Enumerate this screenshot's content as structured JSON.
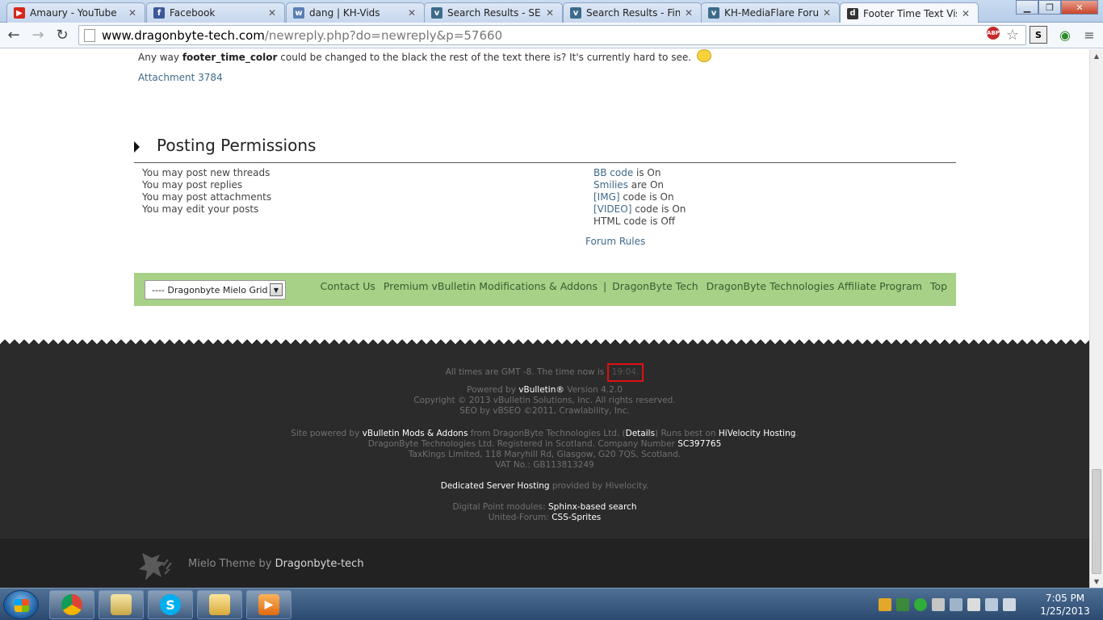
{
  "browser": {
    "tabs": [
      {
        "label": "Amaury - YouTube",
        "favicon": "youtube-icon",
        "color": "#d6261d"
      },
      {
        "label": "Facebook",
        "favicon": "facebook-icon",
        "color": "#3b5998"
      },
      {
        "label": "dang | KH-Vids",
        "favicon": "kh-vids-icon",
        "color": "#5a7fb5"
      },
      {
        "label": "Search Results - SEGA",
        "favicon": "vbulletin-icon",
        "color": "#3d6b8a"
      },
      {
        "label": "Search Results - Final",
        "favicon": "vbulletin-icon",
        "color": "#3d6b8a"
      },
      {
        "label": "KH-MediaFlare Forum",
        "favicon": "vbulletin-icon",
        "color": "#3d6b8a"
      },
      {
        "label": "Footer Time Text Visib",
        "favicon": "dragonbyte-icon",
        "color": "#333333"
      }
    ],
    "url_host": "www.dragonbyte-tech.com",
    "url_path": "/newreply.php?do=newreply&p=57660"
  },
  "post": {
    "text_before": "Any way ",
    "text_bold": "footer_time_color",
    "text_after": " could be changed to the black the rest of the text there is? It's currently hard to see.",
    "attachment": "Attachment 3784"
  },
  "permissions": {
    "title": "Posting Permissions",
    "left": [
      "You may post new threads",
      "You may post replies",
      "You may post attachments",
      "You may edit your posts"
    ],
    "right": [
      {
        "link": "BB code",
        "rest": " is On"
      },
      {
        "link": "Smilies",
        "rest": " are On"
      },
      {
        "link": "[IMG]",
        "rest": " code is On"
      },
      {
        "link": "[VIDEO]",
        "rest": " code is On"
      },
      {
        "link": "",
        "rest": "HTML code is Off"
      }
    ],
    "forum_rules": "Forum Rules"
  },
  "footer_bar": {
    "style_select": "---- Dragonbyte Mielo Grid",
    "links": [
      "Contact Us",
      "Premium vBulletin Modifications & Addons",
      "DragonByte Tech",
      "DragonByte Technologies Affiliate Program",
      "Top"
    ],
    "pipe": "|"
  },
  "footer": {
    "time_prefix": "All times are GMT -8. The time now is",
    "time_value": "19:04",
    "time_suffix": ".",
    "powered_by_prefix": "Powered by",
    "powered_by_brand": "vBulletin®",
    "powered_by_version": " Version 4.2.0",
    "copyright": "Copyright © 2013 vBulletin Solutions, Inc. All rights reserved.",
    "seo": "SEO by vBSEO ©2011, Crawlability, Inc.",
    "site_powered_prefix": "Site powered by",
    "site_powered_link": "vBulletin Mods & Addons",
    "site_powered_mid": " from DragonByte Technologies Ltd. (",
    "details": "Details",
    "site_powered_mid2": ") Runs best on",
    "hivelocity_hosting": "HiVelocity Hosting",
    "registered": "DragonByte Technologies Ltd. Registered in Scotland. Company Number",
    "company_number": "SC397765",
    "address": "TaxKings Limited, 118 Maryhill Rd, Glasgow, G20 7QS, Scotland.",
    "vat": "VAT No.: GB113813249",
    "dedicated": "Dedicated Server Hosting",
    "provided_by": " provided by Hivelocity.",
    "dp_prefix": "Digital Point modules:",
    "dp_link": "Sphinx-based search",
    "uf_prefix": "United-Forum:",
    "uf_link": "CSS-Sprites",
    "theme_prefix": "Mielo Theme by ",
    "theme_link": "Dragonbyte-tech"
  },
  "taskbar": {
    "time": "7:05 PM",
    "date": "1/25/2013"
  }
}
